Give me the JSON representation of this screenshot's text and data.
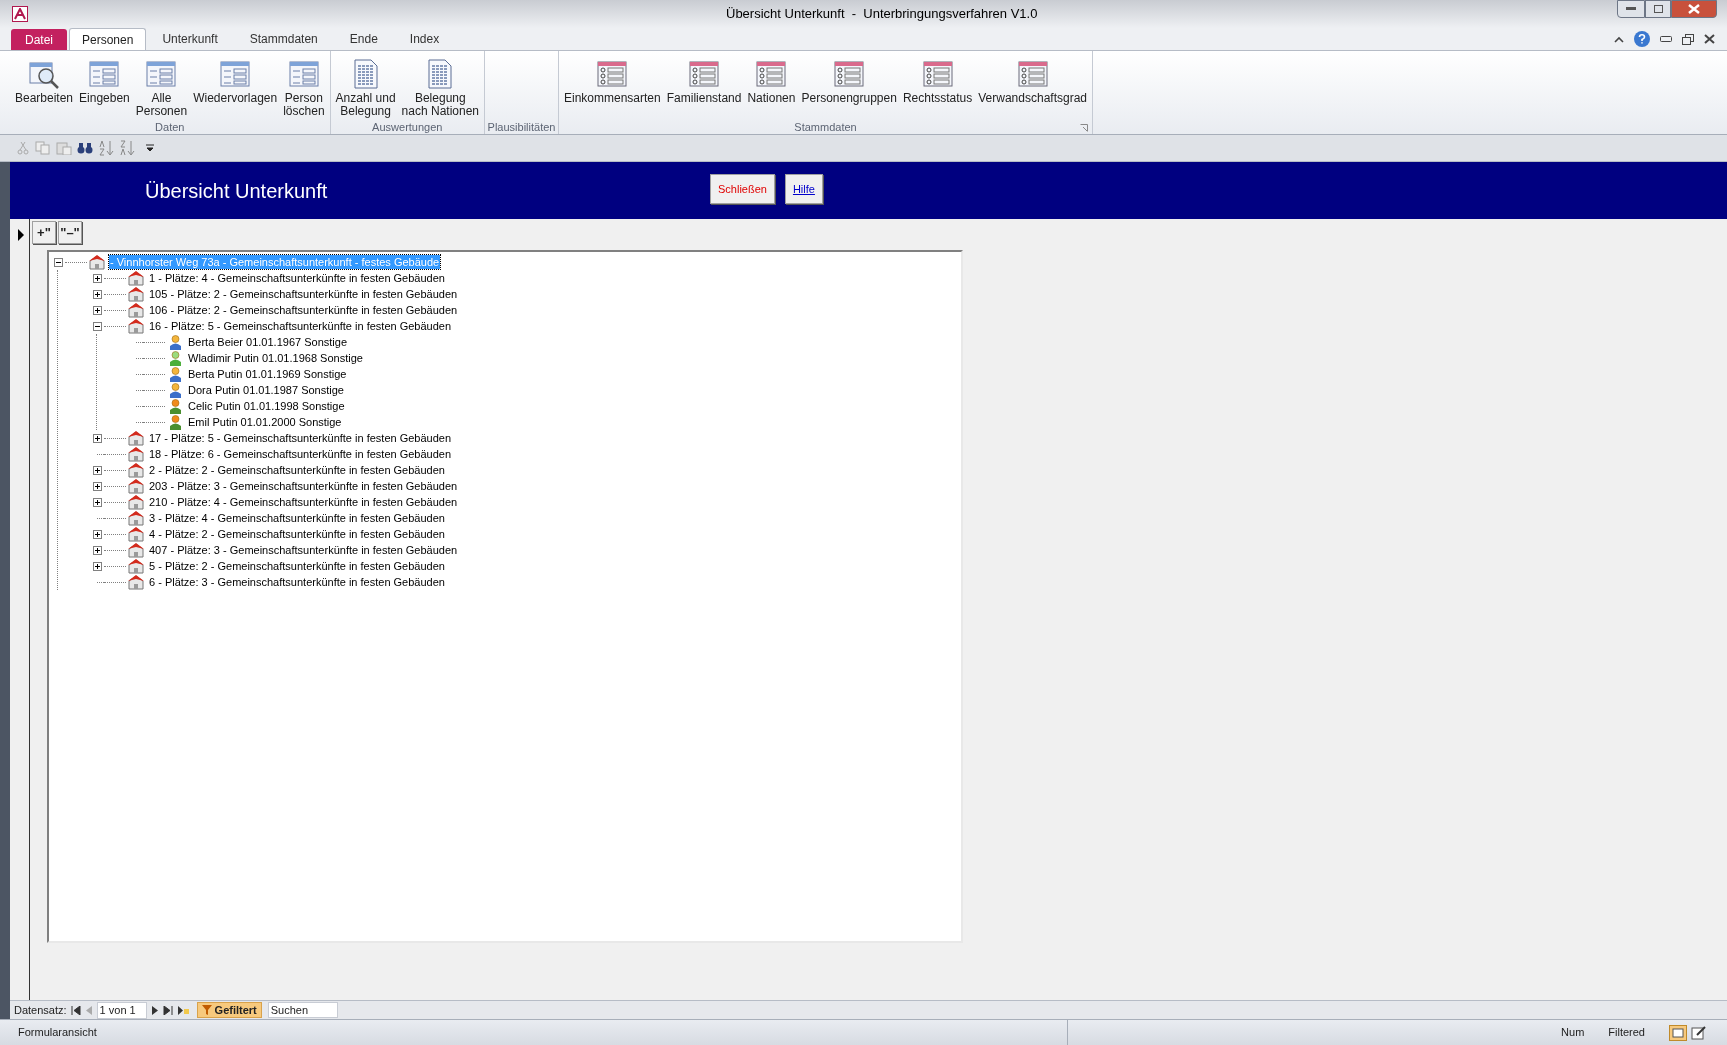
{
  "window": {
    "title": "Übersicht Unterkunft  -  Unterbringungsverfahren V1.0"
  },
  "file_tab": "Datei",
  "tabs": [
    {
      "label": "Personen",
      "selected": true
    },
    {
      "label": "Unterkunft",
      "selected": false
    },
    {
      "label": "Stammdaten",
      "selected": false
    },
    {
      "label": "Ende",
      "selected": false
    },
    {
      "label": "Index",
      "selected": false
    }
  ],
  "ribbon_groups": [
    {
      "label": "Daten",
      "buttons": [
        {
          "label": "Bearbeiten",
          "kind": "search"
        },
        {
          "label": "Eingeben",
          "kind": "form"
        },
        {
          "label": "Alle\nPersonen",
          "kind": "form"
        },
        {
          "label": "Wiedervorlagen",
          "kind": "form"
        },
        {
          "label": "Person\nlöschen",
          "kind": "form"
        }
      ]
    },
    {
      "label": "Auswertungen",
      "buttons": [
        {
          "label": "Anzahl und\nBelegung",
          "kind": "report"
        },
        {
          "label": "Belegung\nnach Nationen",
          "kind": "report"
        }
      ]
    },
    {
      "label": "Plausibilitäten"
    },
    {
      "label": "Stammdaten",
      "buttons": [
        {
          "label": "Einkommensarten",
          "kind": "table"
        },
        {
          "label": "Familienstand",
          "kind": "table"
        },
        {
          "label": "Nationen",
          "kind": "table"
        },
        {
          "label": "Personengruppen",
          "kind": "table"
        },
        {
          "label": "Rechtsstatus",
          "kind": "table"
        },
        {
          "label": "Verwandschaftsgrad",
          "kind": "table"
        }
      ]
    }
  ],
  "form": {
    "title": "Übersicht Unterkunft",
    "buttons": [
      {
        "label": "Schließen",
        "kind": "close"
      },
      {
        "label": "Hilfe",
        "kind": "help"
      }
    ],
    "tree_buttons": [
      "+\"",
      "\"–\""
    ]
  },
  "tree": [
    {
      "label": "- Vinnhorster Weg 73a - Gemeinschaftsunterkunft - festes Gebäude",
      "kind": "site",
      "expandable": true,
      "expanded": true,
      "selected": true,
      "children": [
        {
          "label": "1 - Plätze: 4 - Gemeinschaftsunterkünfte in festen Gebäuden",
          "kind": "room",
          "expandable": true,
          "expanded": false,
          "selected": false
        },
        {
          "label": "105 - Plätze: 2 - Gemeinschaftsunterkünfte in festen Gebäuden",
          "kind": "room",
          "expandable": true,
          "expanded": false,
          "selected": false
        },
        {
          "label": "106 - Plätze: 2 - Gemeinschaftsunterkünfte in festen Gebäuden",
          "kind": "room",
          "expandable": true,
          "expanded": false,
          "selected": false
        },
        {
          "label": "16 - Plätze: 5 - Gemeinschaftsunterkünfte in festen Gebäuden",
          "kind": "room",
          "expandable": true,
          "expanded": true,
          "selected": false,
          "children": [
            {
              "label": "Berta Beier 01.01.1967 Sonstige",
              "kind": "woman",
              "expandable": false,
              "expanded": false,
              "selected": false
            },
            {
              "label": "Wladimir Putin 01.01.1968 Sonstige",
              "kind": "man",
              "expandable": false,
              "expanded": false,
              "selected": false
            },
            {
              "label": "Berta Putin 01.01.1969 Sonstige",
              "kind": "woman",
              "expandable": false,
              "expanded": false,
              "selected": false
            },
            {
              "label": "Dora Putin 01.01.1987 Sonstige",
              "kind": "woman",
              "expandable": false,
              "expanded": false,
              "selected": false
            },
            {
              "label": "Celic Putin 01.01.1998 Sonstige",
              "kind": "child",
              "expandable": false,
              "expanded": false,
              "selected": false
            },
            {
              "label": "Emil Putin 01.01.2000 Sonstige",
              "kind": "child",
              "expandable": false,
              "expanded": false,
              "selected": false
            }
          ]
        },
        {
          "label": "17 - Plätze: 5 - Gemeinschaftsunterkünfte in festen Gebäuden",
          "kind": "room",
          "expandable": true,
          "expanded": false,
          "selected": false
        },
        {
          "label": "18 - Plätze: 6 - Gemeinschaftsunterkünfte in festen Gebäuden",
          "kind": "room",
          "expandable": false,
          "expanded": false,
          "selected": false
        },
        {
          "label": "2 - Plätze: 2 - Gemeinschaftsunterkünfte in festen Gebäuden",
          "kind": "room",
          "expandable": true,
          "expanded": false,
          "selected": false
        },
        {
          "label": "203 - Plätze: 3 - Gemeinschaftsunterkünfte in festen Gebäuden",
          "kind": "room",
          "expandable": true,
          "expanded": false,
          "selected": false
        },
        {
          "label": "210 - Plätze: 4 - Gemeinschaftsunterkünfte in festen Gebäuden",
          "kind": "room",
          "expandable": true,
          "expanded": false,
          "selected": false
        },
        {
          "label": "3 - Plätze: 4 - Gemeinschaftsunterkünfte in festen Gebäuden",
          "kind": "room",
          "expandable": false,
          "expanded": false,
          "selected": false
        },
        {
          "label": "4 - Plätze: 2 - Gemeinschaftsunterkünfte in festen Gebäuden",
          "kind": "room",
          "expandable": true,
          "expanded": false,
          "selected": false
        },
        {
          "label": "407 - Plätze: 3 - Gemeinschaftsunterkünfte in festen Gebäuden",
          "kind": "room",
          "expandable": true,
          "expanded": false,
          "selected": false
        },
        {
          "label": "5 - Plätze: 2 - Gemeinschaftsunterkünfte in festen Gebäuden",
          "kind": "room",
          "expandable": true,
          "expanded": false,
          "selected": false
        },
        {
          "label": "6 - Plätze: 3 - Gemeinschaftsunterkünfte in festen Gebäuden",
          "kind": "room",
          "expandable": false,
          "expanded": false,
          "selected": false
        }
      ]
    }
  ],
  "record_nav": {
    "label": "Datensatz:",
    "position": "1 von 1",
    "filter": "Gefiltert",
    "search_placeholder": "Suchen"
  },
  "status_bar": {
    "view": "Formularansicht",
    "num": "Num",
    "filtered": "Filtered"
  }
}
